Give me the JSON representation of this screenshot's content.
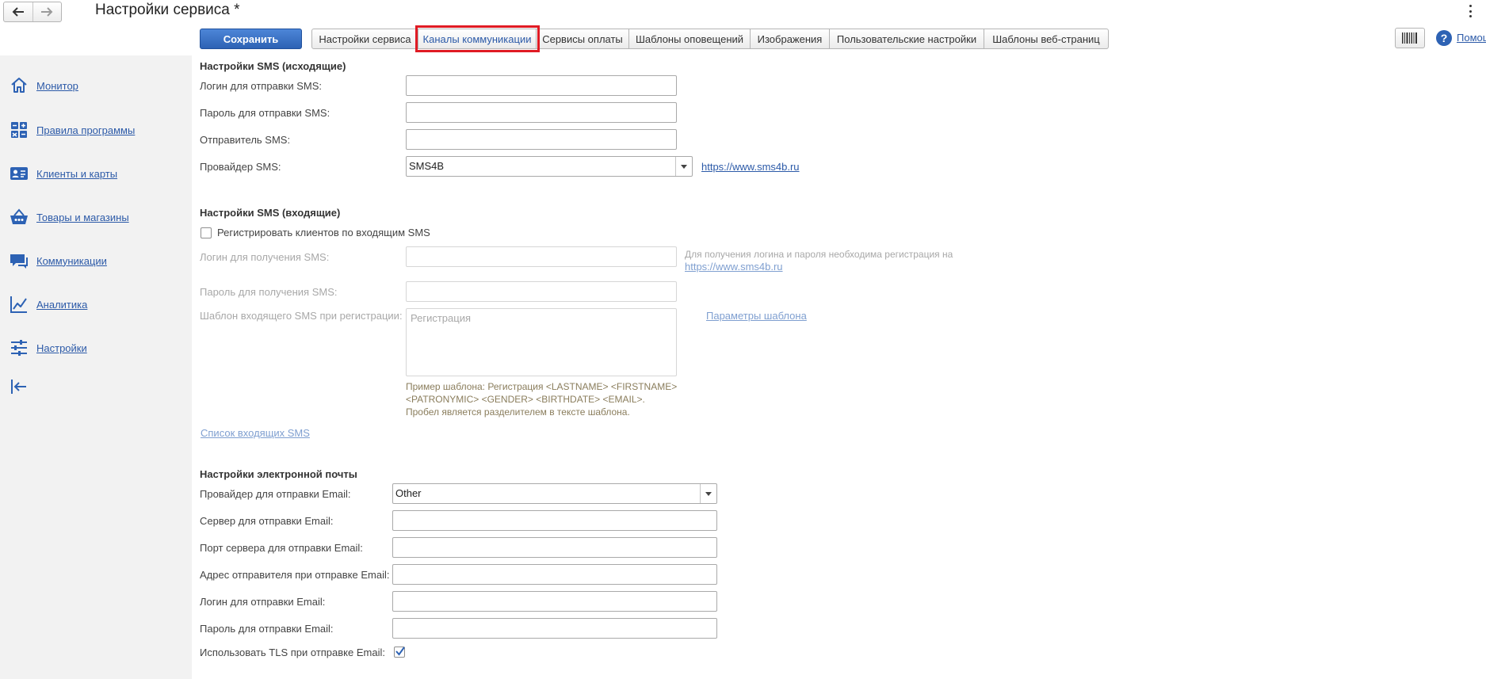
{
  "window": {
    "title": "Настройки сервиса *"
  },
  "toolbar": {
    "save_label": "Сохранить",
    "tabs": [
      {
        "label": "Настройки сервиса"
      },
      {
        "label": "Каналы коммуникации"
      },
      {
        "label": "Сервисы оплаты"
      },
      {
        "label": "Шаблоны оповещений"
      },
      {
        "label": "Изображения"
      },
      {
        "label": "Пользовательские настройки"
      },
      {
        "label": "Шаблоны веб-страниц"
      }
    ],
    "active_tab": "Каналы коммуникации",
    "help_label": "Помощь"
  },
  "sidebar": {
    "items": [
      {
        "label": "Монитор",
        "icon": "home-icon"
      },
      {
        "label": "Правила программы",
        "icon": "grid-icon"
      },
      {
        "label": "Клиенты и карты",
        "icon": "id-card-icon"
      },
      {
        "label": "Товары и магазины",
        "icon": "basket-icon"
      },
      {
        "label": "Коммуникации",
        "icon": "chat-icon"
      },
      {
        "label": "Аналитика",
        "icon": "chart-icon"
      },
      {
        "label": "Настройки",
        "icon": "sliders-icon"
      }
    ],
    "collapse_icon": "collapse-arrow-icon"
  },
  "sms_out": {
    "heading": "Настройки SMS (исходящие)",
    "login_label": "Логин для отправки SMS:",
    "login_value": "",
    "password_label": "Пароль для отправки SMS:",
    "password_value": "",
    "sender_label": "Отправитель SMS:",
    "sender_value": "",
    "provider_label": "Провайдер SMS:",
    "provider_value": "SMS4B",
    "provider_link": "https://www.sms4b.ru"
  },
  "sms_in": {
    "heading": "Настройки SMS (входящие)",
    "register_checkbox_label": "Регистрировать клиентов по входящим SMS",
    "register_checked": false,
    "login_label": "Логин для получения SMS:",
    "login_value": "",
    "note_text": "Для получения логина и пароля необходима регистрация на",
    "note_link": "https://www.sms4b.ru",
    "password_label": "Пароль для получения SMS:",
    "password_value": "",
    "template_label": "Шаблон входящего SMS при регистрации:",
    "template_value": "Регистрация",
    "template_params_link": "Параметры шаблона",
    "hint_line1": "Пример шаблона: Регистрация <LASTNAME> <FIRSTNAME>",
    "hint_line2": "<PATRONYMIC> <GENDER> <BIRTHDATE> <EMAIL>.",
    "hint_line3": "Пробел является разделителем в тексте шаблона.",
    "incoming_list_link": "Список входящих SMS"
  },
  "email": {
    "heading": "Настройки электронной почты",
    "provider_label": "Провайдер для отправки Email:",
    "provider_value": "Other",
    "server_label": "Сервер для отправки Email:",
    "server_value": "",
    "port_label": "Порт сервера для отправки Email:",
    "port_value": "",
    "sender_label": "Адрес отправителя при отправке Email:",
    "sender_value": "",
    "login_label": "Логин для отправки Email:",
    "login_value": "",
    "password_label": "Пароль для отправки Email:",
    "password_value": "",
    "tls_label": "Использовать TLS при отправке Email:",
    "tls_checked": true
  }
}
